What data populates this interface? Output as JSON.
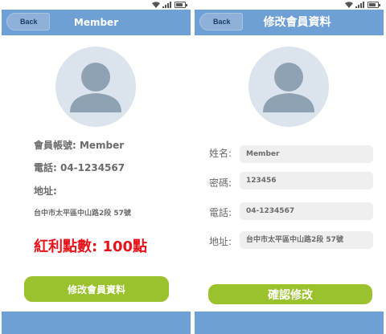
{
  "left_screen": {
    "back_label": "Back",
    "title": "Member",
    "account_label": "會員帳號: Member",
    "phone_label": "電話: 04-1234567",
    "address_label": "地址:",
    "address_value": "台中市太平區中山路2段 57號",
    "points_label": "紅利點數: 100點",
    "edit_button_label": "修改會員資料"
  },
  "right_screen": {
    "back_label": "Back",
    "title": "修改會員資料",
    "fields": [
      {
        "label": "姓名:",
        "value": "Member"
      },
      {
        "label": "密碼:",
        "value": "123456"
      },
      {
        "label": "電話:",
        "value": "04-1234567"
      },
      {
        "label": "地址:",
        "value": "台中市太平區中山路2段 57號"
      }
    ],
    "confirm_button_label": "確認修改"
  },
  "colors": {
    "appbar": "#6e9fd5",
    "accent_button": "#9ac22c",
    "points_text": "#e8121a",
    "avatar_bg": "#dbe4ed",
    "avatar_figure": "#8fa2b3"
  },
  "icons": [
    "wifi-icon",
    "signal-icon",
    "battery-icon",
    "avatar-icon"
  ]
}
